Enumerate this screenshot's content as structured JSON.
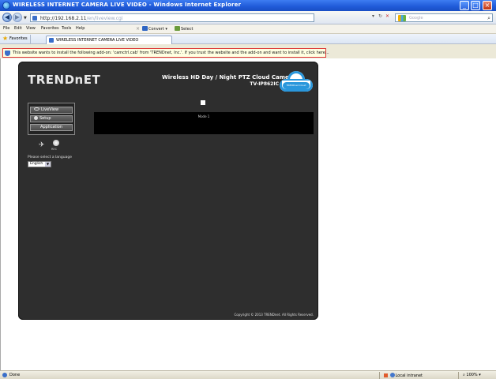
{
  "window": {
    "title": "WIRELESS INTERNET CAMERA LIVE VIDEO - Windows Internet Explorer"
  },
  "address_bar": {
    "url_host": "http://192.168.2.11",
    "url_rest": "/en/liveview.cgi",
    "search_placeholder": "Google"
  },
  "menu": {
    "items": [
      "File",
      "Edit",
      "View",
      "Favorites",
      "Tools",
      "Help"
    ],
    "convert_label": "Convert",
    "select_label": "Select"
  },
  "favorites_bar": {
    "favorites_label": "Favorites",
    "tab_label": "WIRELESS INTERNET CAMERA LIVE VIDEO"
  },
  "info_bar": {
    "message": "This website wants to install the following add-on: 'camctrl.cab' from 'TRENDnet, Inc.'. If you trust the website and the add-on and want to install it, click here..."
  },
  "camera_page": {
    "brand": "TRENDnET",
    "product_title": "Wireless HD Day / Night PTZ Cloud Camera",
    "model": "TV-IP862IC",
    "cloud_badge_text": "TRENDnet Cloud",
    "buttons": {
      "live_view": "LiveView",
      "setup": "Setup",
      "application": "Application"
    },
    "rec_label": "REC",
    "language_prompt": "Please select a language",
    "language_selected": "English",
    "video_label": "Mode 1",
    "copyright": "Copyright © 2013 TRENDnet. All Rights Reserved."
  },
  "status_bar": {
    "status": "Done",
    "zone": "Local intranet",
    "zoom": "100%"
  }
}
